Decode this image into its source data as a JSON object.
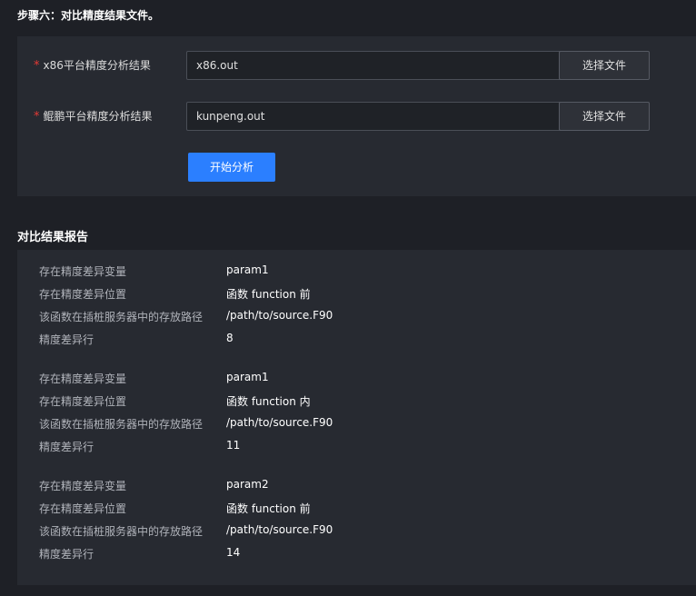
{
  "step": {
    "title": "步骤六：对比精度结果文件。"
  },
  "form": {
    "required_mark": "*",
    "x86": {
      "label": "x86平台精度分析结果",
      "value": "x86.out",
      "button": "选择文件"
    },
    "kunpeng": {
      "label": "鲲鹏平台精度分析结果",
      "value": "kunpeng.out",
      "button": "选择文件"
    },
    "start_button": "开始分析"
  },
  "report": {
    "title": "对比结果报告",
    "groups": [
      {
        "items": [
          {
            "key": "存在精度差异变量",
            "value": "param1"
          },
          {
            "key": "存在精度差异位置",
            "value": "函数 function 前"
          },
          {
            "key": "该函数在插桩服务器中的存放路径",
            "value": "/path/to/source.F90"
          },
          {
            "key": "精度差异行",
            "value": "8"
          }
        ]
      },
      {
        "items": [
          {
            "key": "存在精度差异变量",
            "value": "param1"
          },
          {
            "key": "存在精度差异位置",
            "value": "函数 function 内"
          },
          {
            "key": "该函数在插桩服务器中的存放路径",
            "value": "/path/to/source.F90"
          },
          {
            "key": "精度差异行",
            "value": "11"
          }
        ]
      },
      {
        "items": [
          {
            "key": "存在精度差异变量",
            "value": "param2"
          },
          {
            "key": "存在精度差异位置",
            "value": "函数 function 前"
          },
          {
            "key": "该函数在插桩服务器中的存放路径",
            "value": "/path/to/source.F90"
          },
          {
            "key": "精度差异行",
            "value": "14"
          }
        ]
      }
    ]
  }
}
